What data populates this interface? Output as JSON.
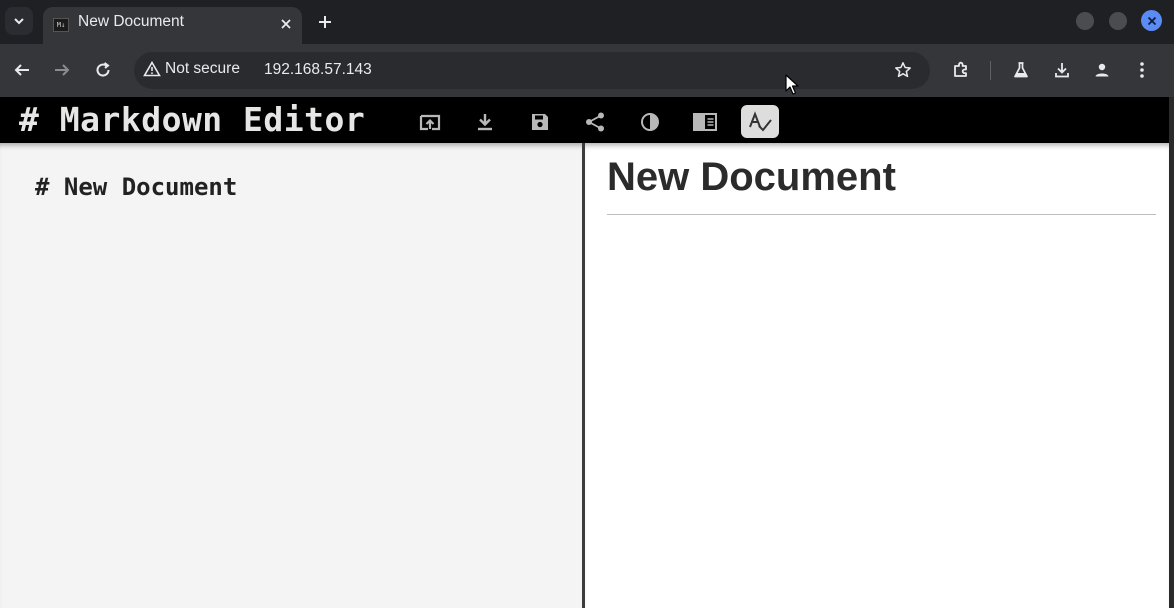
{
  "browser": {
    "tab": {
      "title": "New Document",
      "favicon_text": "M↓"
    },
    "address": {
      "security_label": "Not secure",
      "url": "192.168.57.143"
    }
  },
  "app": {
    "title": "# Markdown Editor",
    "toolbar_icons": [
      "open-file-icon",
      "download-icon",
      "save-icon",
      "share-icon",
      "contrast-icon",
      "toggle-preview-icon",
      "spellcheck-icon"
    ],
    "spellcheck_active": true
  },
  "editor": {
    "content": "# New Document"
  },
  "preview": {
    "heading": "New Document"
  },
  "colors": {
    "accent": "#5b8cf5",
    "editor_bg": "#f4f4f4",
    "header_bg": "#000000"
  }
}
